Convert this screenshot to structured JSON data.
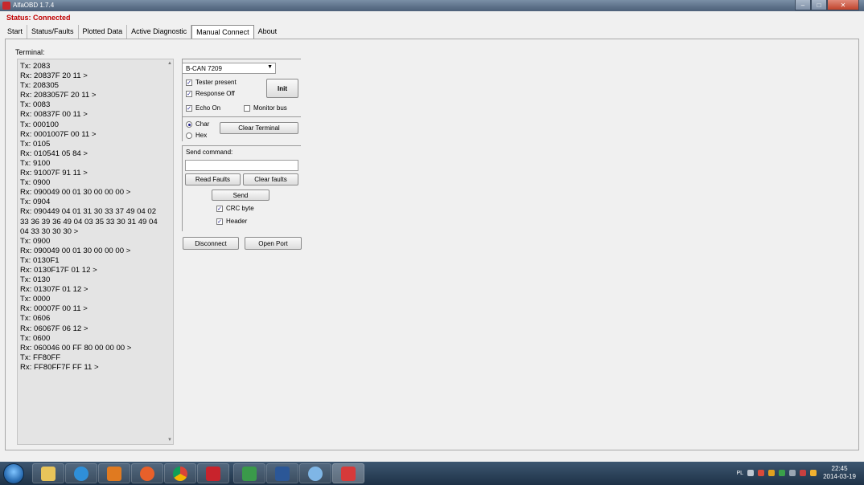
{
  "window": {
    "title": "AlfaOBD 1.7.4",
    "min_glyph": "–",
    "max_glyph": "□",
    "close_glyph": "✕"
  },
  "status": "Status: Connected",
  "tabs": [
    {
      "label": "Start"
    },
    {
      "label": "Status/Faults"
    },
    {
      "label": "Plotted Data"
    },
    {
      "label": "Active Diagnostic"
    },
    {
      "label": "Manual Connect",
      "active": true
    },
    {
      "label": "About"
    }
  ],
  "terminal": {
    "label": "Terminal:",
    "lines": [
      "Tx: 2083",
      "Rx: 20837F 20 11 >",
      "Tx: 208305",
      "Rx: 2083057F 20 11 >",
      "Tx: 0083",
      "Rx: 00837F 00 11 >",
      "Tx: 000100",
      "Rx: 0001007F 00 11 >",
      "Tx: 0105",
      "Rx: 010541 05 84 >",
      "Tx: 9100",
      "Rx: 91007F 91 11 >",
      "Tx: 0900",
      "Rx: 090049 00 01 30 00 00 00 >",
      "Tx: 0904",
      "Rx: 090449 04 01 31 30 33 37 49 04 02 33 36 39 36 49 04 03 35 33 30 31 49 04 04 33 30 30 30 >",
      "Tx: 0900",
      "Rx: 090049 00 01 30 00 00 00 >",
      "Tx: 0130F1",
      "Rx: 0130F17F 01 12 >",
      "Tx: 0130",
      "Rx: 01307F 01 12 >",
      "Tx: 0000",
      "Rx: 00007F 00 11 >",
      "Tx: 0606",
      "Rx: 06067F 06 12 >",
      "Tx: 0600",
      "Rx: 060046 00 FF 80 00 00 00 >",
      "Tx: FF80FF",
      "Rx: FF80FF7F FF 11 >"
    ]
  },
  "controls": {
    "bus_select": "B-CAN 7209",
    "tester_present": {
      "label": "Tester present",
      "checked": true
    },
    "response_off": {
      "label": "Response Off",
      "checked": true
    },
    "init_button": "Init",
    "echo_on": {
      "label": "Echo On",
      "checked": true
    },
    "monitor_bus": {
      "label": "Monitor bus",
      "checked": false
    },
    "mode_char": {
      "label": "Char",
      "selected": true
    },
    "mode_hex": {
      "label": "Hex",
      "selected": false
    },
    "clear_terminal": "Clear Terminal",
    "send_command_label": "Send command:",
    "command_value": "",
    "read_faults": "Read Faults",
    "clear_faults": "Clear faults",
    "send_button": "Send",
    "crc_byte": {
      "label": "CRC byte",
      "checked": true
    },
    "header": {
      "label": "Header",
      "checked": true
    },
    "disconnect": "Disconnect",
    "open_port": "Open Port",
    "check_glyph": "✓"
  },
  "taskbar": {
    "apps": [
      "explorer-icon",
      "internet-explorer-icon",
      "media-player-icon",
      "firefox-icon",
      "chrome-icon",
      "acrobat-icon",
      "remote-icon",
      "word-icon",
      "paint-icon",
      "alfaobd-icon"
    ],
    "tray_lang": "PL",
    "time": "22:45",
    "date": "2014-03-19"
  }
}
